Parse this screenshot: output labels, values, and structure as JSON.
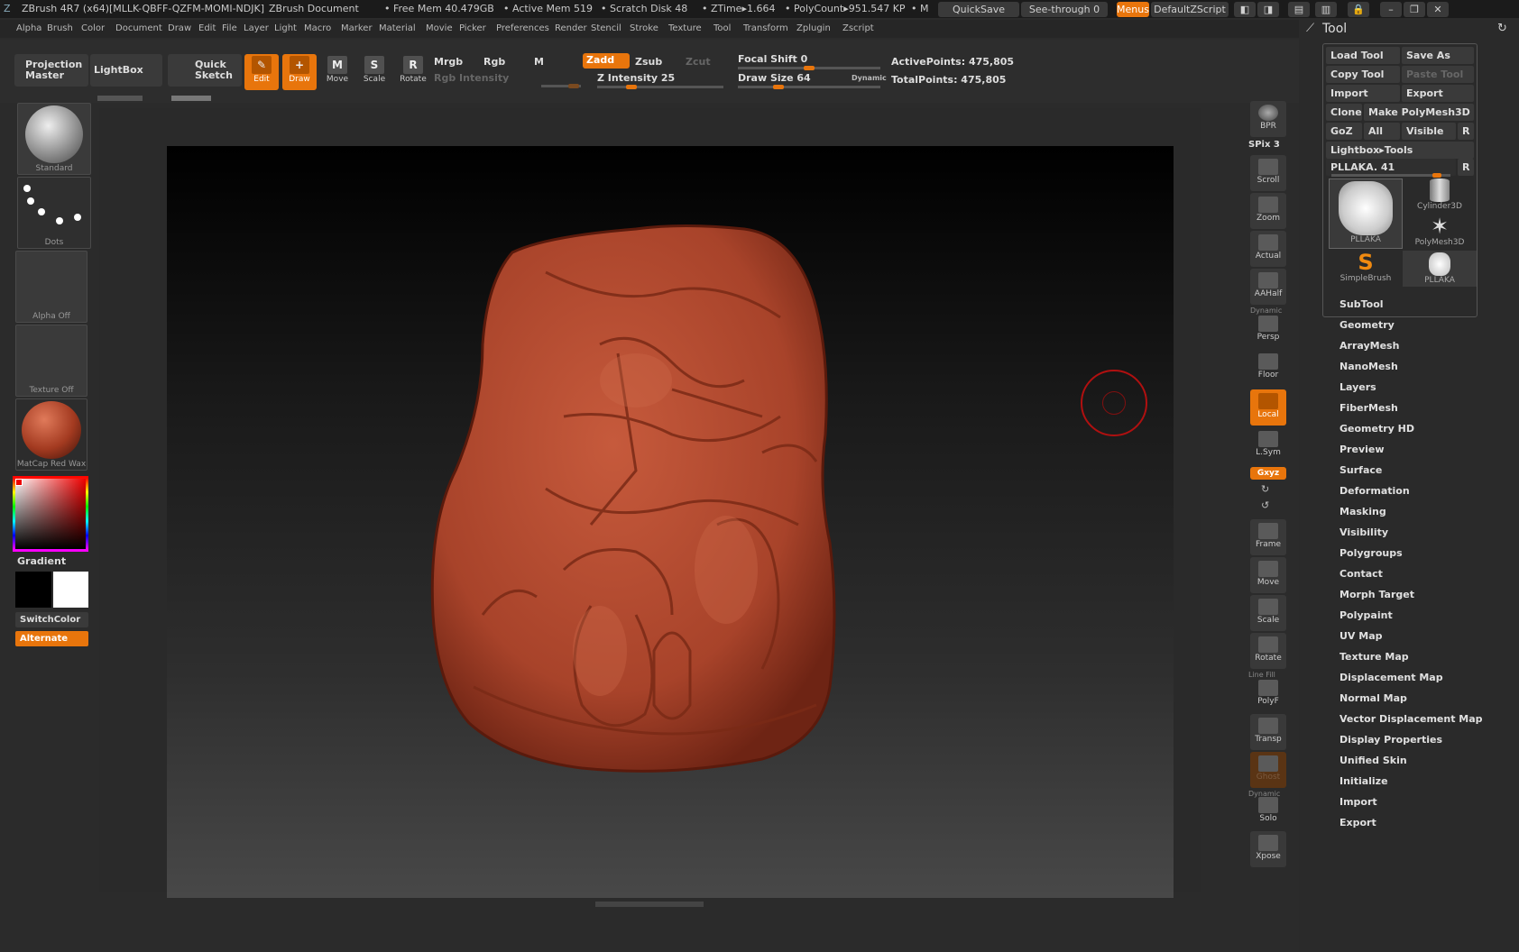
{
  "titlebar": {
    "app": "ZBrush 4R7 (x64)[MLLK-QBFF-QZFM-MOMI-NDJK]",
    "doc": "ZBrush Document",
    "free_mem": "• Free Mem 40.479GB",
    "active_mem": "• Active Mem 519",
    "scratch": "• Scratch Disk 48",
    "ztime": "• ZTime▸1.664",
    "polycount": "• PolyCount▸951.547 KP",
    "trail": "• M",
    "quicksave": "QuickSave",
    "seethrough": "See-through  0",
    "menus": "Menus",
    "zscript": "DefaultZScript"
  },
  "menubar": [
    "Alpha",
    "Brush",
    "Color",
    "Document",
    "Draw",
    "Edit",
    "File",
    "Layer",
    "Light",
    "Macro",
    "Marker",
    "Material",
    "Movie",
    "Picker",
    "Preferences",
    "Render",
    "Stencil",
    "Stroke",
    "Texture",
    "Tool",
    "Transform",
    "Zplugin",
    "Zscript"
  ],
  "toolbar": {
    "projection_master": "Projection Master",
    "lightbox": "LightBox",
    "quick_sketch": "Quick Sketch",
    "edit": "Edit",
    "draw": "Draw",
    "move": "Move",
    "scale": "Scale",
    "rotate": "Rotate",
    "mrgb": "Mrgb",
    "rgb": "Rgb",
    "m": "M",
    "rgb_intensity": "Rgb Intensity",
    "zadd": "Zadd",
    "zsub": "Zsub",
    "zcut": "Zcut",
    "z_intensity": "Z Intensity 25",
    "focal_shift": "Focal Shift 0",
    "draw_size": "Draw Size 64",
    "dynamic": "Dynamic",
    "active_points": "ActivePoints: 475,805",
    "total_points": "TotalPoints: 475,805",
    "z_intensity_value": 25,
    "draw_size_value": 64,
    "focal_shift_value": 0
  },
  "left": {
    "brush": "Standard",
    "stroke": "Dots",
    "alpha": "Alpha Off",
    "texture": "Texture Off",
    "material": "MatCap Red Wax",
    "gradient": "Gradient",
    "switch_color": "SwitchColor",
    "alternate": "Alternate"
  },
  "rightbar": {
    "bpr": "BPR",
    "spix": "SPix 3",
    "scroll": "Scroll",
    "zoom": "Zoom",
    "actual": "Actual",
    "aahalf": "AAHalf",
    "dynamic": "Dynamic",
    "persp": "Persp",
    "floor": "Floor",
    "local": "Local",
    "lsym": "L.Sym",
    "xyz": "Gxyz",
    "frame": "Frame",
    "move": "Move",
    "scale": "Scale",
    "rotate": "Rotate",
    "line_fill": "Line Fill",
    "polyf": "PolyF",
    "transp": "Transp",
    "ghost": "Ghost",
    "dynamic2": "Dynamic",
    "solo": "Solo",
    "xpose": "Xpose"
  },
  "toolpanel": {
    "title": "Tool",
    "load_tool": "Load Tool",
    "save_as": "Save As",
    "copy_tool": "Copy Tool",
    "paste_tool": "Paste Tool",
    "import": "Import",
    "export": "Export",
    "clone": "Clone",
    "make_polymesh": "Make PolyMesh3D",
    "goz": "GoZ",
    "all": "All",
    "visible": "Visible",
    "r": "R",
    "lightbox_tools": "Lightbox▸Tools",
    "current_tool": "PLLAKA. 41",
    "tools": [
      "PLLAKA",
      "Cylinder3D",
      "PolyMesh3D",
      "SimpleBrush",
      "PLLAKA"
    ],
    "sections": [
      "SubTool",
      "Geometry",
      "ArrayMesh",
      "NanoMesh",
      "Layers",
      "FiberMesh",
      "Geometry HD",
      "Preview",
      "Surface",
      "Deformation",
      "Masking",
      "Visibility",
      "Polygroups",
      "Contact",
      "Morph Target",
      "Polypaint",
      "UV Map",
      "Texture Map",
      "Displacement Map",
      "Normal Map",
      "Vector Displacement Map",
      "Display Properties",
      "Unified Skin",
      "Initialize",
      "Import",
      "Export"
    ]
  },
  "colors": {
    "accent": "#e8750c",
    "model": "#b34a2e",
    "background": "#2b2b2b"
  }
}
